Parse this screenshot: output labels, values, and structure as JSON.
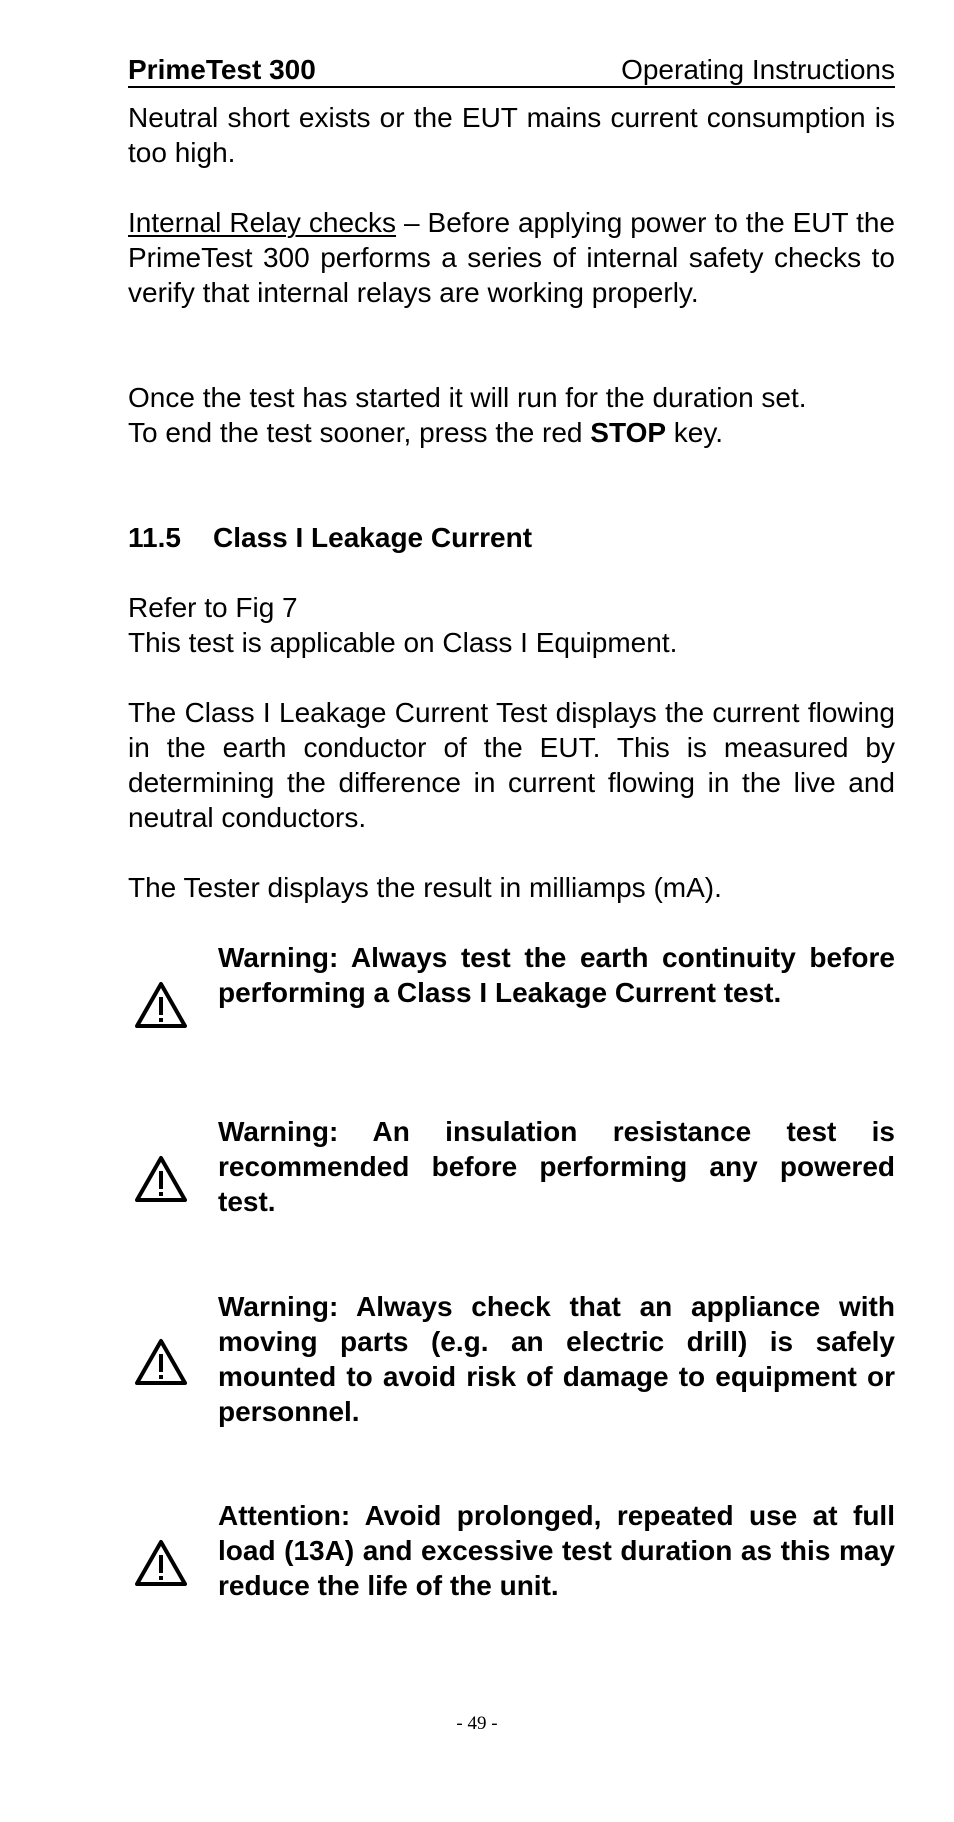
{
  "header": {
    "product": "PrimeTest 300",
    "doc_title": "Operating Instructions"
  },
  "intro": {
    "text": "Neutral short exists or the EUT mains current consumption is too high."
  },
  "relay_checks": {
    "label": "Internal Relay checks",
    "text": " – Before applying power to the EUT the PrimeTest 300 performs a series of internal safety checks to verify that internal relays are working properly."
  },
  "test_duration": {
    "line1": "Once the test has started it will run for the duration set.",
    "line2_prefix": "To end the test sooner, press the red ",
    "line2_key": "STOP",
    "line2_suffix": " key."
  },
  "section": {
    "number": "11.5",
    "title": "Class I Leakage Current"
  },
  "refer": {
    "line1": "Refer to Fig 7",
    "line2": "This test is applicable on Class I Equipment."
  },
  "description": {
    "text": "The Class I Leakage Current Test displays the current flowing in the earth conductor of the EUT. This is measured by determining the difference in current flowing in the live and neutral conductors."
  },
  "result_units": {
    "text": "The Tester displays the result in milliamps (mA)."
  },
  "warnings": [
    {
      "icon": "warning-triangle-icon",
      "text": "Warning: Always test the earth continuity before performing a Class I Leakage Current test."
    },
    {
      "icon": "warning-triangle-icon",
      "text": "Warning: An insulation resistance test is recommended before performing any powered test."
    },
    {
      "icon": "warning-triangle-icon",
      "text": "Warning: Always check that an appliance with moving parts (e.g. an electric drill) is safely mounted to avoid risk of damage to equipment or personnel."
    },
    {
      "icon": "warning-triangle-icon",
      "text": "Attention: Avoid prolonged, repeated use at full load (13A) and excessive test duration as this may reduce the life of the unit."
    }
  ],
  "footer": {
    "page_number": "- 49 -"
  }
}
